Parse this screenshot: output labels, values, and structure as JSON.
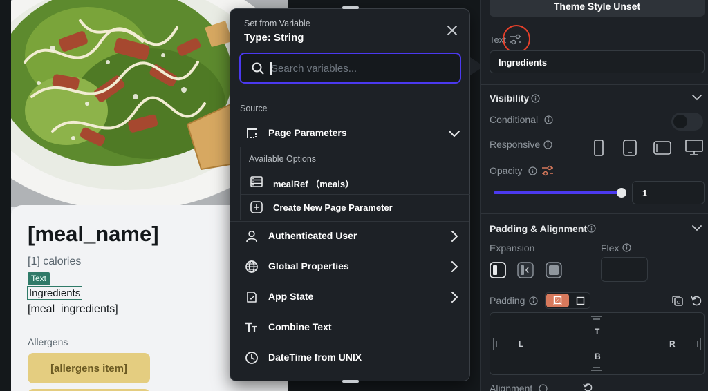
{
  "canvas": {
    "meal_name": "[meal_name]",
    "calories": "[1] calories",
    "selected_badge": "Text",
    "ingredients_label": "Ingredients",
    "meal_ingredients": "[meal_ingredients]",
    "allergens_label": "Allergens",
    "allergen_chip": "[allergens item]"
  },
  "popover": {
    "subtitle": "Set from Variable",
    "title": "Type: String",
    "search_placeholder": "Search variables...",
    "source_label": "Source",
    "page_parameters": {
      "label": "Page Parameters",
      "available_options_label": "Available Options",
      "options": [
        {
          "label": "mealRef （meals）"
        }
      ],
      "create_label": "Create New Page Parameter"
    },
    "sources": [
      {
        "label": "Authenticated User",
        "icon": "person-icon",
        "has_chevron": true
      },
      {
        "label": "Global Properties",
        "icon": "globe-icon",
        "has_chevron": true
      },
      {
        "label": "App State",
        "icon": "app-state-icon",
        "has_chevron": true
      },
      {
        "label": "Combine Text",
        "icon": "text-format-icon",
        "has_chevron": false
      },
      {
        "label": "DateTime from UNIX",
        "icon": "clock-icon",
        "has_chevron": false
      }
    ]
  },
  "panel": {
    "theme_style_button": "Theme Style Unset",
    "text_label": "Text",
    "text_value": "Ingredients",
    "visibility_title": "Visibility",
    "conditional_label": "Conditional",
    "responsive_label": "Responsive",
    "opacity_label": "Opacity",
    "opacity_value": "1",
    "opacity_level": 1.0,
    "padding_alignment_title": "Padding & Alignment",
    "expansion_label": "Expansion",
    "flex_label": "Flex",
    "padding_label": "Padding",
    "padding_sides": {
      "top": "T",
      "left": "L",
      "right": "R",
      "bottom": "B"
    },
    "alignment_label": "Alignment"
  },
  "colors": {
    "accent": "#4b39ef",
    "highlight_circle": "#e8402a",
    "selection_badge": "#2f7a68",
    "allergen_chip": "#e4cd80",
    "padding_mode_active": "#d7795c",
    "panel_bg": "#1d2126"
  }
}
